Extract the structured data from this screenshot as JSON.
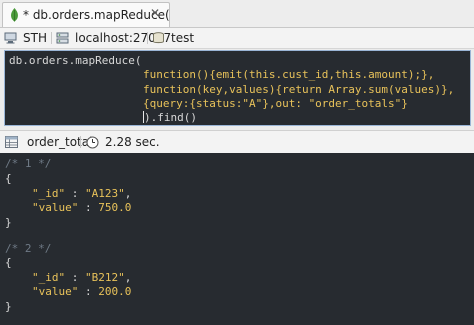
{
  "tab": {
    "title": "* db.orders.mapReduce(",
    "close_icon": "close-icon"
  },
  "connection": {
    "name": "STH",
    "host": "localhost:27017",
    "database": "test"
  },
  "editor": {
    "lines": [
      "db.orders.mapReduce(",
      "function(){emit(this.cust_id,this.amount);},",
      "function(key,values){return Array.sum(values)},",
      "{query:{status:\"A\"},out: \"order_totals\"}",
      ").find()"
    ]
  },
  "results": {
    "collection": "order_totals",
    "time": "2.28 sec."
  },
  "output": {
    "documents": [
      {
        "comment": "/* 1 */",
        "open": "{",
        "id_key": "\"_id\"",
        "id_value": "\"A123\"",
        "value_key": "\"value\"",
        "value_value": "750.0",
        "close": "}"
      },
      {
        "comment": "/* 2 */",
        "open": "{",
        "id_key": "\"_id\"",
        "id_value": "\"B212\"",
        "value_key": "\"value\"",
        "value_value": "200.0",
        "close": "}"
      }
    ]
  },
  "colors": {
    "editor_bg": "#272b30",
    "keyword": "#e8c25a",
    "comment": "#6f7a86",
    "mongo_leaf": "#4a9a3a"
  }
}
